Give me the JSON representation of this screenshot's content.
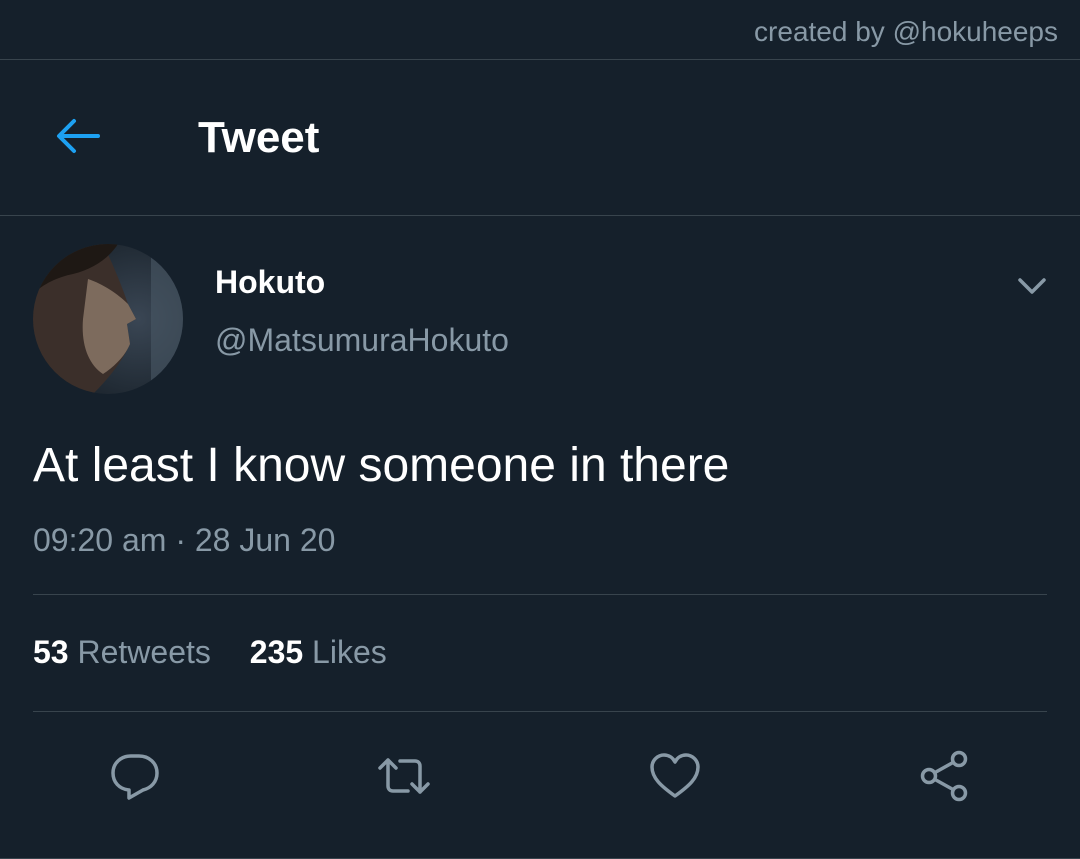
{
  "credit": "created by @hokuheeps",
  "header": {
    "title": "Tweet",
    "back_icon": "arrow-left-icon"
  },
  "tweet": {
    "name": "Hokuto",
    "handle": "@MatsumuraHokuto",
    "text": "At least I know someone in there",
    "time": "09:20 am",
    "separator": "·",
    "date": "28 Jun 20",
    "retweets_count": "53",
    "retweets_label": "Retweets",
    "likes_count": "235",
    "likes_label": "Likes"
  },
  "actions": {
    "reply_icon": "reply-icon",
    "retweet_icon": "retweet-icon",
    "like_icon": "heart-icon",
    "share_icon": "share-icon"
  },
  "colors": {
    "background": "#15202b",
    "accent": "#1da1f2",
    "secondary_text": "#8899a6",
    "divider": "#38444d"
  }
}
